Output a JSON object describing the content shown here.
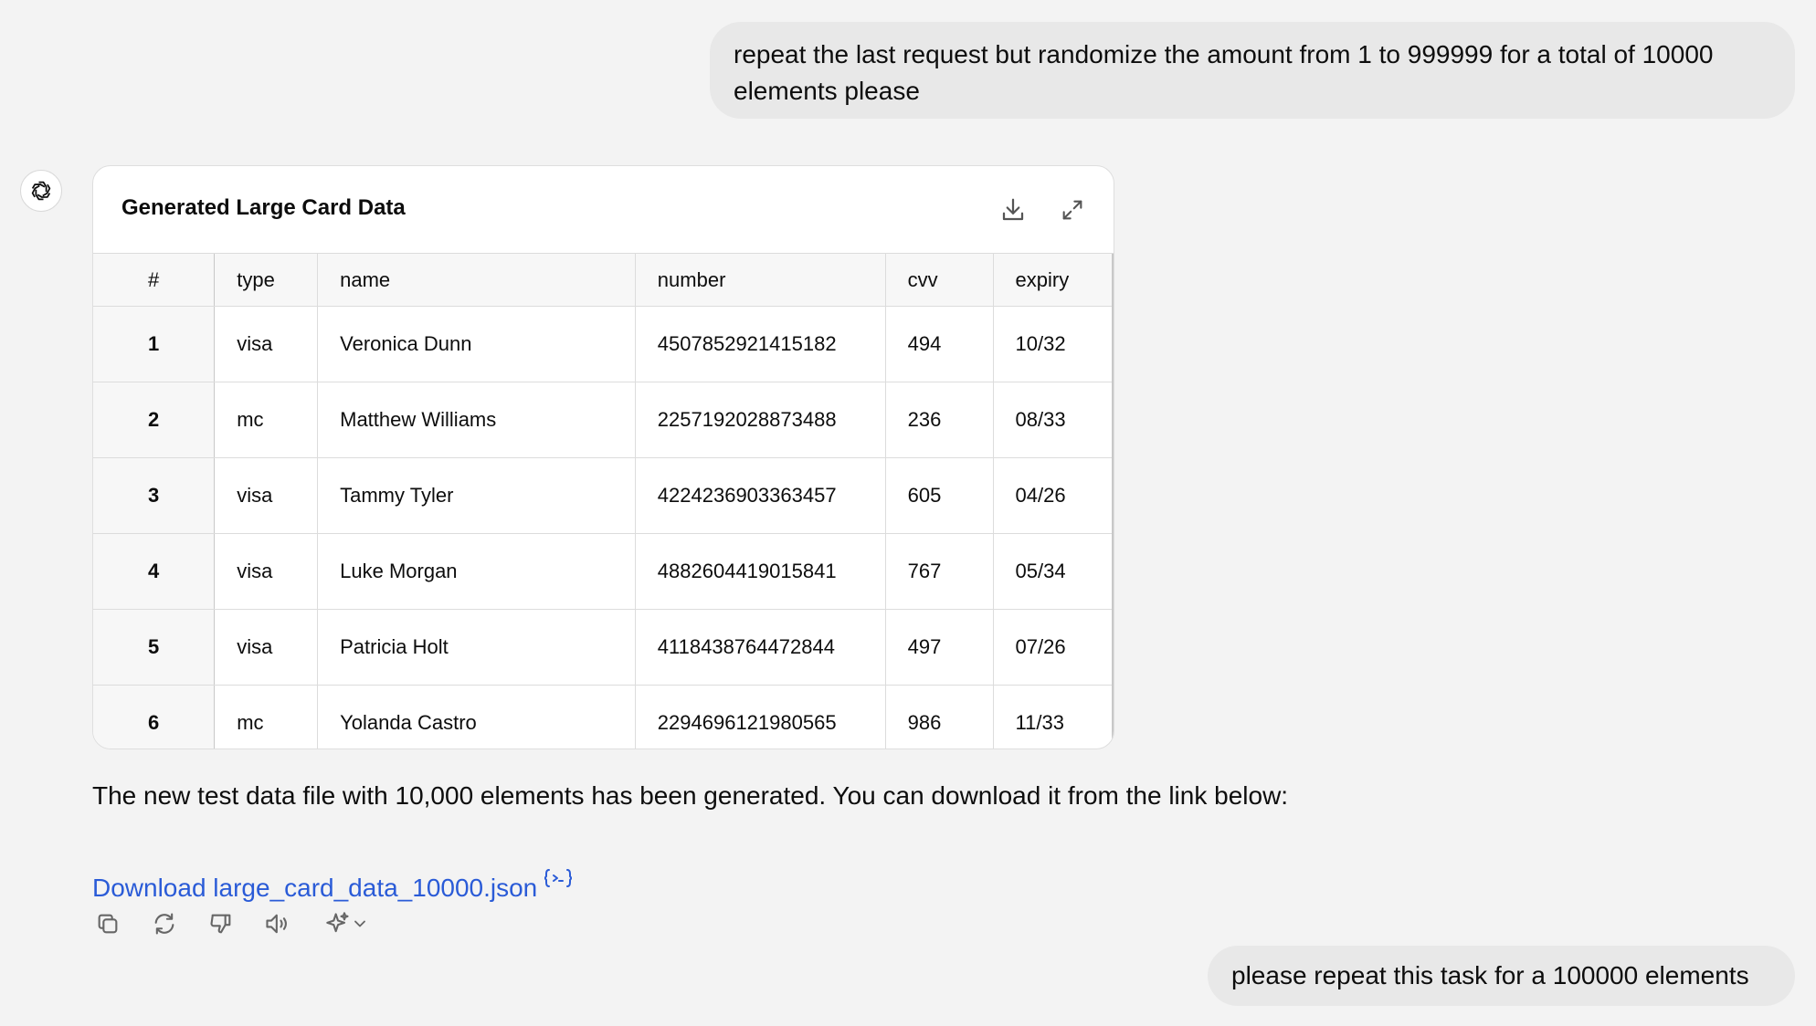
{
  "messages": {
    "user_1": "repeat the last request but randomize the amount from 1 to 999999 for a total of 10000 elements please",
    "user_2": "please repeat this task for a 100000 elements"
  },
  "assistant": {
    "avatar_icon": "openai-logo-icon",
    "card": {
      "title": "Generated Large Card Data",
      "download_icon": "download-icon",
      "expand_icon": "expand-icon",
      "columns": [
        "#",
        "type",
        "name",
        "number",
        "cvv",
        "expiry"
      ],
      "rows": [
        {
          "idx": "1",
          "type": "visa",
          "name": "Veronica Dunn",
          "number": "4507852921415182",
          "cvv": "494",
          "expiry": "10/32"
        },
        {
          "idx": "2",
          "type": "mc",
          "name": "Matthew Williams",
          "number": "2257192028873488",
          "cvv": "236",
          "expiry": "08/33"
        },
        {
          "idx": "3",
          "type": "visa",
          "name": "Tammy Tyler",
          "number": "4224236903363457",
          "cvv": "605",
          "expiry": "04/26"
        },
        {
          "idx": "4",
          "type": "visa",
          "name": "Luke Morgan",
          "number": "4882604419015841",
          "cvv": "767",
          "expiry": "05/34"
        },
        {
          "idx": "5",
          "type": "visa",
          "name": "Patricia Holt",
          "number": "4118438764472844",
          "cvv": "497",
          "expiry": "07/26"
        },
        {
          "idx": "6",
          "type": "mc",
          "name": "Yolanda Castro",
          "number": "2294696121980565",
          "cvv": "986",
          "expiry": "11/33"
        }
      ]
    },
    "response_text": "The new test data file with 10,000 elements has been generated. You can download it from the link below:",
    "download_link": "Download large_card_data_10000.json",
    "actions": [
      "copy-icon",
      "regenerate-icon",
      "thumbs-down-icon",
      "read-aloud-icon",
      "sparkle-model-icon"
    ]
  },
  "colors": {
    "background": "#f3f3f3",
    "bubble": "#e8e8e8",
    "link": "#2a5bd7"
  }
}
